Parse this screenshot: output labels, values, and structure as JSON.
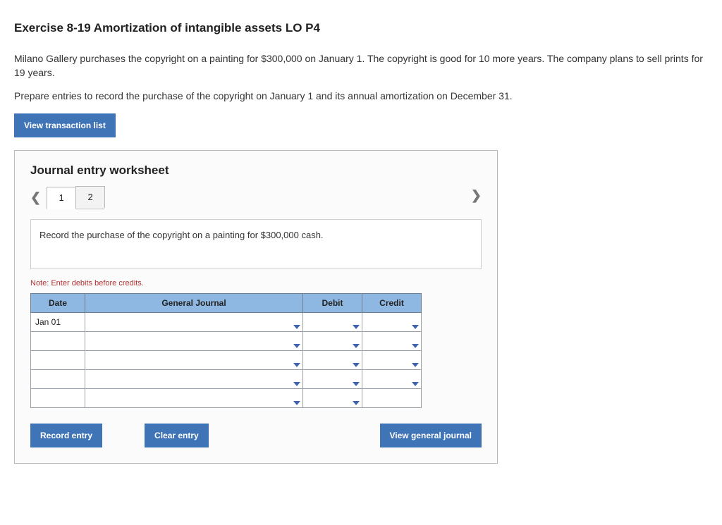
{
  "title": "Exercise 8-19 Amortization of intangible assets LO P4",
  "problem1": "Milano Gallery purchases the copyright on a painting for $300,000 on January 1. The copyright is good for 10 more years. The company plans to sell prints for 19 years.",
  "problem2": "Prepare entries to record the purchase of the copyright on January 1 and its annual amortization on December 31.",
  "view_tx_btn": "View transaction list",
  "worksheet": {
    "title": "Journal entry worksheet",
    "tabs": [
      "1",
      "2"
    ],
    "prompt": "Record the purchase of the copyright on a painting for $300,000 cash.",
    "note": "Note: Enter debits before credits.",
    "columns": {
      "date": "Date",
      "general": "General Journal",
      "debit": "Debit",
      "credit": "Credit"
    },
    "rows": [
      {
        "date": "Jan 01"
      },
      {},
      {},
      {},
      {}
    ],
    "buttons": {
      "record": "Record entry",
      "clear": "Clear entry",
      "view_journal": "View general journal"
    }
  }
}
